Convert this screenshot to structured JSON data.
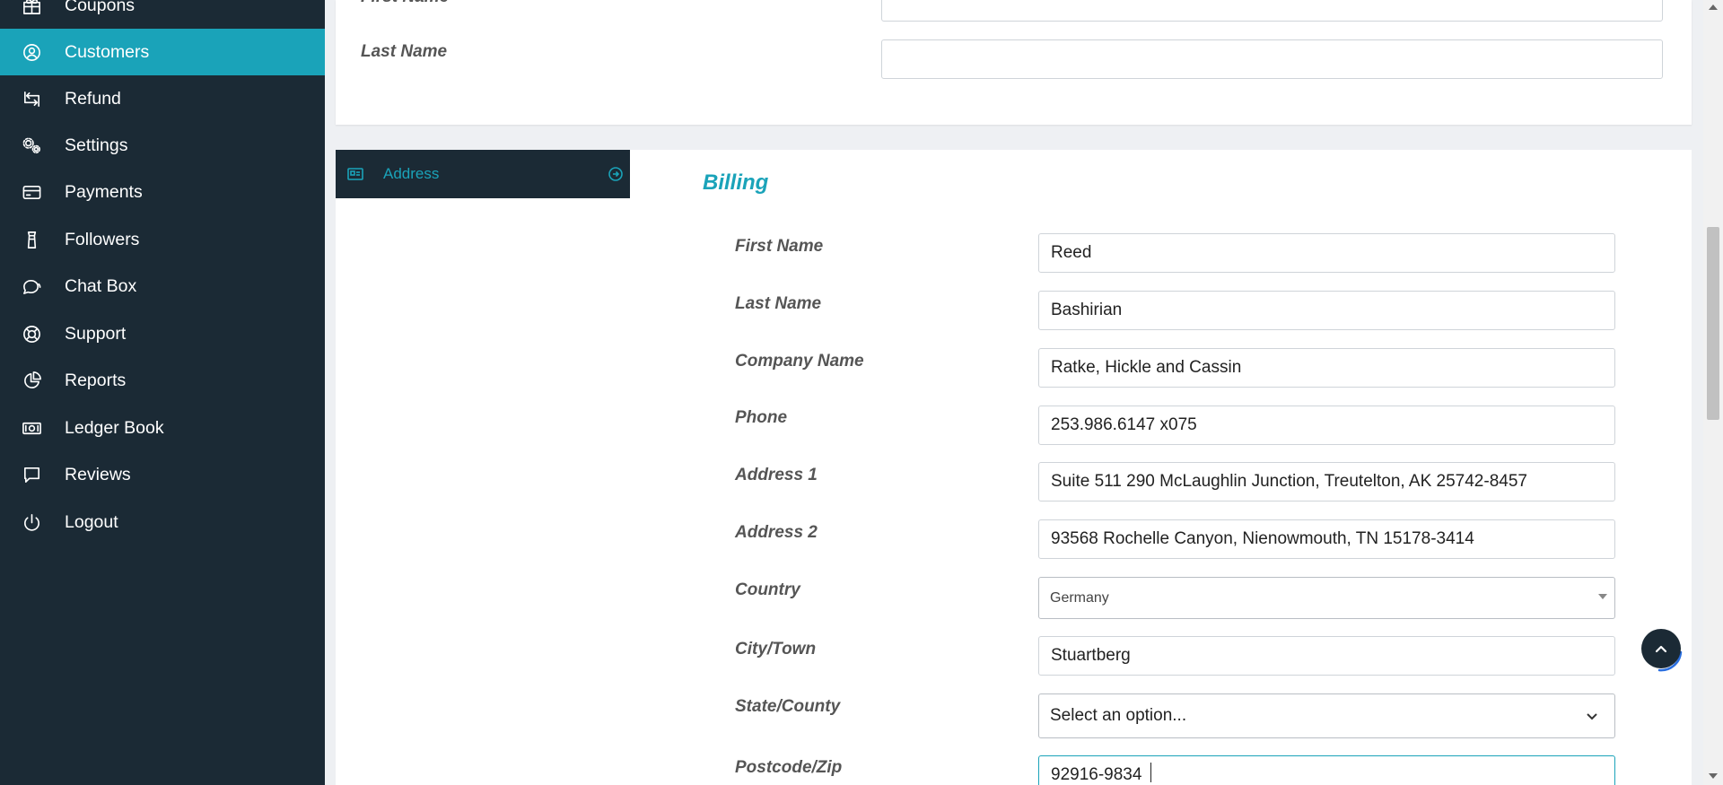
{
  "sidebar": {
    "items": [
      {
        "label": "Coupons",
        "icon": "gift-icon",
        "active": false
      },
      {
        "label": "Customers",
        "icon": "user-circle-icon",
        "active": true
      },
      {
        "label": "Refund",
        "icon": "refund-icon",
        "active": false
      },
      {
        "label": "Settings",
        "icon": "gears-icon",
        "active": false
      },
      {
        "label": "Payments",
        "icon": "credit-card-icon",
        "active": false
      },
      {
        "label": "Followers",
        "icon": "shirt-icon",
        "active": false
      },
      {
        "label": "Chat Box",
        "icon": "chat-icon",
        "active": false
      },
      {
        "label": "Support",
        "icon": "lifebuoy-icon",
        "active": false
      },
      {
        "label": "Reports",
        "icon": "pie-chart-icon",
        "active": false
      },
      {
        "label": "Ledger Book",
        "icon": "banknote-icon",
        "active": false
      },
      {
        "label": "Reviews",
        "icon": "comment-icon",
        "active": false
      },
      {
        "label": "Logout",
        "icon": "power-icon",
        "active": false
      }
    ]
  },
  "top_card": {
    "first_name_label": "First Name",
    "first_name_value": "",
    "last_name_label": "Last Name",
    "last_name_value": ""
  },
  "tabs": {
    "address_label": "Address",
    "address_icon": "id-card-icon",
    "address_end_icon": "circle-arrow-icon"
  },
  "billing": {
    "title": "Billing",
    "first_name": {
      "label": "First Name",
      "value": "Reed"
    },
    "last_name": {
      "label": "Last Name",
      "value": "Bashirian"
    },
    "company_name": {
      "label": "Company Name",
      "value": "Ratke, Hickle and Cassin"
    },
    "phone": {
      "label": "Phone",
      "value": "253.986.6147 x075"
    },
    "address1": {
      "label": "Address 1",
      "value": "Suite 511 290 McLaughlin Junction, Treutelton, AK 25742-8457"
    },
    "address2": {
      "label": "Address 2",
      "value": "93568 Rochelle Canyon, Nienowmouth, TN 15178-3414"
    },
    "country": {
      "label": "Country",
      "value": "Germany"
    },
    "city": {
      "label": "City/Town",
      "value": "Stuartberg"
    },
    "state": {
      "label": "State/County",
      "value": "Select an option..."
    },
    "postcode": {
      "label": "Postcode/Zip",
      "value": "92916-9834"
    }
  },
  "colors": {
    "sidebar_bg": "#1b2a35",
    "accent": "#1aa3b9",
    "page_bg": "#eef0f3"
  }
}
